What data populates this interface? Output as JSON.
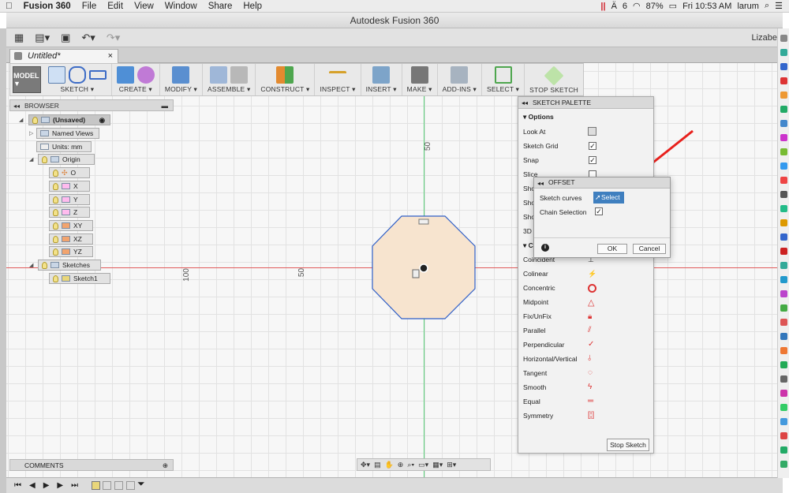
{
  "menubar": {
    "app": "Fusion 360",
    "items": [
      "File",
      "Edit",
      "View",
      "Window",
      "Share",
      "Help"
    ],
    "battery": "87%",
    "clock": "Fri 10:53 AM",
    "user": "larum",
    "badge": "6"
  },
  "window": {
    "title": "Autodesk Fusion 360",
    "user_short": "Lizabet"
  },
  "tab": {
    "label": "Untitled*",
    "close": "×"
  },
  "toolbar": {
    "workspace": "MODEL ▼",
    "groups": [
      "SKETCH ▾",
      "CREATE ▾",
      "MODIFY ▾",
      "ASSEMBLE ▾",
      "CONSTRUCT ▾",
      "INSPECT ▾",
      "INSERT ▾",
      "MAKE ▾",
      "ADD-INS ▾",
      "SELECT ▾",
      "STOP SKETCH"
    ]
  },
  "browser": {
    "title": "BROWSER",
    "root": "(Unsaved)",
    "nodes": [
      "Named Views",
      "Units: mm",
      "Origin",
      "O",
      "X",
      "Y",
      "Z",
      "XY",
      "XZ",
      "YZ",
      "Sketches",
      "Sketch1"
    ]
  },
  "canvas": {
    "dims": {
      "top": "50",
      "left1": "100",
      "left2": "50"
    }
  },
  "palette": {
    "title": "SKETCH PALETTE",
    "options_header": "Options",
    "options": [
      "Look At",
      "Sketch Grid",
      "Snap",
      "Slice",
      "Sho",
      "Sho",
      "Sho",
      "3D"
    ],
    "constraints_header": "Co",
    "constraints": [
      "Coincident",
      "Colinear",
      "Concentric",
      "Midpoint",
      "Fix/UnFix",
      "Parallel",
      "Perpendicular",
      "Horizontal/Vertical",
      "Tangent",
      "Smooth",
      "Equal",
      "Symmetry"
    ],
    "stop": "Stop Sketch"
  },
  "offset": {
    "title": "OFFSET",
    "curves_label": "Sketch curves",
    "select": "Select",
    "chain_label": "Chain Selection",
    "info": "i",
    "ok": "OK",
    "cancel": "Cancel"
  },
  "comments": {
    "title": "COMMENTS"
  },
  "colors": {
    "xaxis": "#e05a5a",
    "yaxis": "#5bd07a",
    "sketch_fill": "#f7e4cf",
    "sketch_edge": "#2f5fc7",
    "arrow": "#e8201c",
    "select_bg": "#3f7fbf"
  }
}
